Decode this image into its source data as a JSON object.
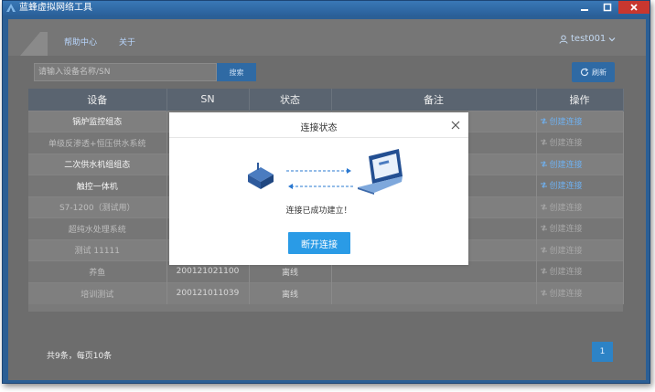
{
  "window": {
    "title": "蓝蜂虚拟网络工具",
    "icon": "app-logo-icon",
    "controls": [
      "minimize-icon",
      "maximize-icon",
      "close-icon"
    ]
  },
  "nav": {
    "help": "帮助中心",
    "about": "关于",
    "user": "test001"
  },
  "toolbar": {
    "search_placeholder": "请输入设备名称/SN",
    "search_label": "搜索",
    "refresh_label": "刷新"
  },
  "table": {
    "headers": [
      "设备",
      "SN",
      "状态",
      "备注",
      "操作"
    ],
    "rows": [
      {
        "name": "锅炉监控组态",
        "sn": "",
        "status": "",
        "note": "",
        "action": "创建连接",
        "online": true
      },
      {
        "name": "单级反渗透+恒压供水系统",
        "sn": "",
        "status": "",
        "note": "",
        "action": "创建连接",
        "online": false
      },
      {
        "name": "二次供水机组组态",
        "sn": "",
        "status": "",
        "note": "",
        "action": "创建连接",
        "online": true
      },
      {
        "name": "触控一体机",
        "sn": "",
        "status": "",
        "note": "",
        "action": "创建连接",
        "online": true
      },
      {
        "name": "S7-1200（测试用）",
        "sn": "",
        "status": "",
        "note": "",
        "action": "创建连接",
        "online": false
      },
      {
        "name": "超纯水处理系统",
        "sn": "",
        "status": "",
        "note": "",
        "action": "创建连接",
        "online": false
      },
      {
        "name": "测试 11111",
        "sn": "",
        "status": "",
        "note": "",
        "action": "创建连接",
        "online": false
      },
      {
        "name": "养鱼",
        "sn": "200121021100",
        "status": "离线",
        "note": "",
        "action": "创建连接",
        "online": false
      },
      {
        "name": "培训测试",
        "sn": "200121011039",
        "status": "离线",
        "note": "",
        "action": "创建连接",
        "online": false
      }
    ]
  },
  "footer": {
    "count": "共9条，每页10条",
    "page": "1"
  },
  "modal": {
    "title": "连接状态",
    "message": "连接已成功建立！",
    "button": "断开连接"
  },
  "colors": {
    "accent": "#2a9be6",
    "link": "#6fb0ef",
    "titlebar": "#2b5f95",
    "close": "#c8372f"
  }
}
